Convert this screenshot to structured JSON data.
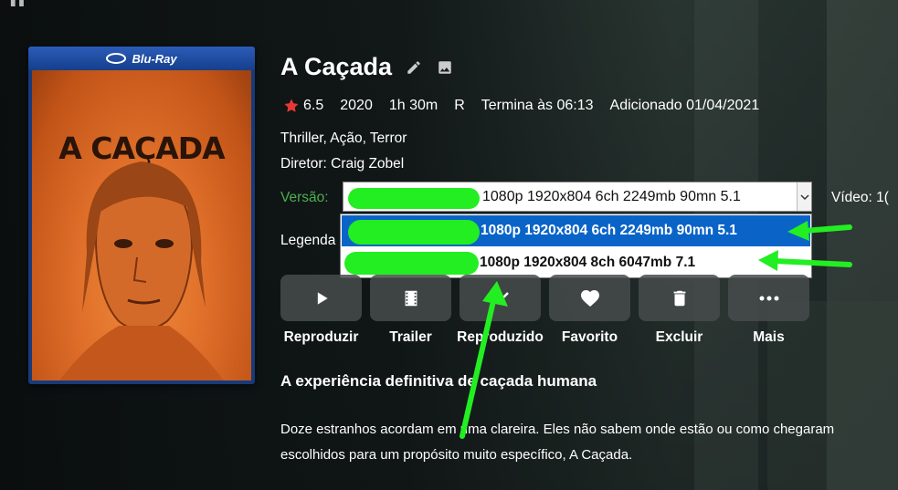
{
  "poster": {
    "badge": "Blu-Ray",
    "title": "A CAÇADA"
  },
  "movie": {
    "title": "A Caçada",
    "rating": "6.5",
    "year": "2020",
    "runtime": "1h 30m",
    "age_rating": "R",
    "ends_at": "Termina às 06:13",
    "added": "Adicionado 01/04/2021",
    "genres": "Thriller, Ação, Terror",
    "director": "Diretor: Craig Zobel"
  },
  "version": {
    "label": "Versão:",
    "selected": "1080p 1920x804 6ch 2249mb 90mn 5.1",
    "options": [
      "1080p 1920x804 6ch 2249mb 90mn 5.1",
      "1080p 1920x804 8ch 6047mb 7.1"
    ]
  },
  "video_label": "Vídeo: 1(",
  "subtitle_label": "Legenda",
  "actions": [
    {
      "label": "Reproduzir",
      "icon": "play-icon"
    },
    {
      "label": "Trailer",
      "icon": "film-icon"
    },
    {
      "label": "Reproduzido",
      "icon": "check-icon"
    },
    {
      "label": "Favorito",
      "icon": "heart-icon"
    },
    {
      "label": "Excluir",
      "icon": "trash-icon"
    },
    {
      "label": "Mais",
      "icon": "more-icon"
    }
  ],
  "tagline": "A experiência definitiva de caçada humana",
  "overview": [
    "Doze estranhos acordam em uma clareira. Eles não sabem onde estão ou como chegaram",
    "escolhidos para um propósito muito específico, A Caçada."
  ],
  "colors": {
    "accent_green": "#4caf50",
    "highlight_green": "#22ee22",
    "selection_blue": "#0a64c8",
    "star_red": "#e53935"
  }
}
